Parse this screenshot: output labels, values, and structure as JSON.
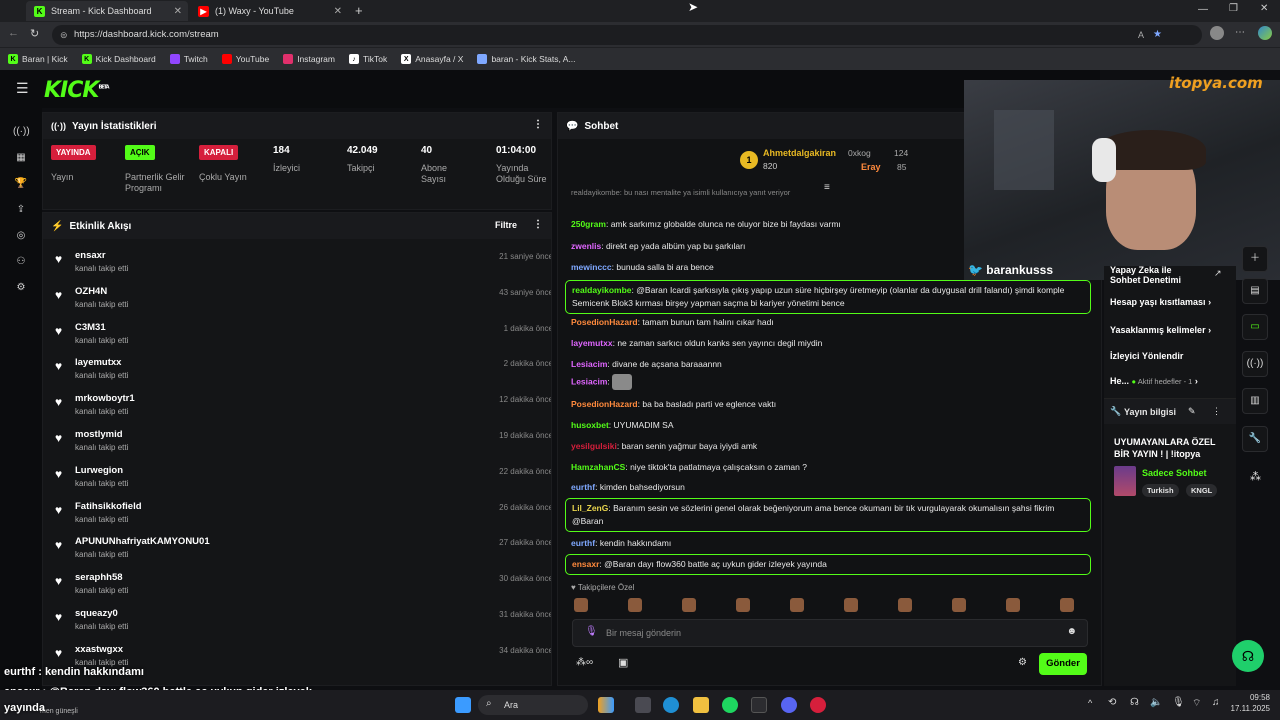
{
  "browser": {
    "tabs": [
      {
        "title": "Stream - Kick Dashboard",
        "active": true,
        "icon": "kick-icon"
      },
      {
        "title": "(1) Waxy - YouTube",
        "active": false,
        "icon": "youtube-icon"
      }
    ],
    "url": "https://dashboard.kick.com/stream",
    "bookmarks": [
      "Baran | Kick",
      "Kick Dashboard",
      "Twitch",
      "YouTube",
      "Instagram",
      "TikTok",
      "Anasayfa / X",
      "baran - Kick Stats, A..."
    ]
  },
  "app": {
    "logo": "KICK",
    "logo_sup": "BETA",
    "stats": {
      "title": "Yayın İstatistikleri",
      "items": [
        {
          "badge": "YAYINDA",
          "label": "Yayın"
        },
        {
          "badge": "AÇIK",
          "label": "Partnerlik Gelir Programı"
        },
        {
          "badge": "KAPALI",
          "label": "Çoklu Yayın"
        },
        {
          "num": "184",
          "label": "İzleyici"
        },
        {
          "num": "42.049",
          "label": "Takipçi"
        },
        {
          "num": "40",
          "label": "Abone Sayısı"
        },
        {
          "num": "01:04:00",
          "label": "Yayında Olduğu Süre"
        }
      ]
    },
    "activity": {
      "title": "Etkinlik Akışı",
      "filter": "Filtre",
      "items": [
        {
          "name": "ensaxr",
          "sub": "kanalı takip etti",
          "time": "21 saniye önce"
        },
        {
          "name": "OZH4N",
          "sub": "kanalı takip etti",
          "time": "43 saniye önce"
        },
        {
          "name": "C3M31",
          "sub": "kanalı takip etti",
          "time": "1 dakika önce"
        },
        {
          "name": "layemutxx",
          "sub": "kanalı takip etti",
          "time": "2 dakika önce"
        },
        {
          "name": "mrkowboytr1",
          "sub": "kanalı takip etti",
          "time": "12 dakika önce"
        },
        {
          "name": "mostlymid",
          "sub": "kanalı takip etti",
          "time": "19 dakika önce"
        },
        {
          "name": "Lurwegion",
          "sub": "kanalı takip etti",
          "time": "22 dakika önce"
        },
        {
          "name": "Fatihsikkofield",
          "sub": "kanalı takip etti",
          "time": "26 dakika önce"
        },
        {
          "name": "APUNUNhafriyatKAMYONU01",
          "sub": "kanalı takip etti",
          "time": "27 dakika önce"
        },
        {
          "name": "seraphh58",
          "sub": "kanalı takip etti",
          "time": "30 dakika önce"
        },
        {
          "name": "squeazy0",
          "sub": "kanalı takip etti",
          "time": "31 dakika önce"
        },
        {
          "name": "xxastwgxx",
          "sub": "kanalı takip etti",
          "time": "34 dakika önce"
        }
      ]
    },
    "chat": {
      "title": "Sohbet",
      "leader": {
        "rank": "1",
        "name": "Ahmetdalgakiran",
        "amount": "820",
        "second": "0xkog",
        "second_amount": "124",
        "third": "Eray",
        "third_amount": "85"
      },
      "reply_note": "realdayikombe: bu nası mentalite ya isimli kullanıcıya yanıt veriyor",
      "messages": [
        {
          "user": "250gram",
          "color": "#53fc18",
          "text": "amk sarkımız globalde olunca ne oluyor bize bi faydası varmı",
          "hl": false
        },
        {
          "user": "zwenlis",
          "color": "#e066ff",
          "text": "direkt ep yada albüm yap bu şarkıları",
          "hl": false
        },
        {
          "user": "mewinccc",
          "color": "#7fa8ff",
          "text": "bunuda salla bi ara bence",
          "hl": false
        },
        {
          "user": "realdayikombe",
          "color": "#53fc18",
          "text": "@Baran Icardi şarkısıyla çıkış yapıp uzun süre hiçbirşey üretmeyip (olanlar da duygusal drill falandı) şimdi komple Semicenk Blok3 kırması birşey yapman saçma bi kariyer yönetimi bence",
          "hl": true
        },
        {
          "user": "PosedionHazard",
          "color": "#ff8a3d",
          "text": "tamam bunun tam halını cıkar hadı",
          "hl": false
        },
        {
          "user": "layemutxx",
          "color": "#e066ff",
          "text": "ne zaman sarkıcı oldun kanks sen yayıncı degil miydin",
          "hl": false
        },
        {
          "user": "Lesiacim",
          "color": "#e066ff",
          "text": "divane de açsana baraaannn",
          "hl": false
        },
        {
          "user": "Lesiacim",
          "color": "#e066ff",
          "text": "",
          "hl": false,
          "emote": true
        },
        {
          "user": "PosedionHazard",
          "color": "#ff8a3d",
          "text": "ba ba basladı parti ve eglence vaktı",
          "hl": false
        },
        {
          "user": "husoxbet",
          "color": "#53fc18",
          "text": "UYUMADIM SA",
          "hl": false
        },
        {
          "user": "yesilgulsiki",
          "color": "#d61f3c",
          "text": "baran senin yağmur baya iyiydi amk",
          "hl": false
        },
        {
          "user": "HamzahanCS",
          "color": "#53fc18",
          "text": "niye tiktok'ta patlatmaya çalışcaksın o zaman ?",
          "hl": false
        },
        {
          "user": "eurthf",
          "color": "#7fa8ff",
          "text": "kimden bahsediyorsun",
          "hl": false
        },
        {
          "user": "Lil_ZenG",
          "color": "#e8d44d",
          "text": "Baranım sesin ve sözlerini genel olarak beğeniyorum ama bence okumanı bir tık vurgulayarak okumalısın şahsi fikrim @Baran",
          "hl": true
        },
        {
          "user": "eurthf",
          "color": "#7fa8ff",
          "text": "kendin hakkındamı",
          "hl": false
        },
        {
          "user": "ensaxr",
          "color": "#ff8a3d",
          "text": "@Baran dayı flow360 battle aç uykun gider izleyek yayında",
          "hl": true
        }
      ],
      "subscribers_label": "Takipçilere Özel",
      "input_placeholder": "Bir mesaj gönderin",
      "send": "Gönder"
    },
    "right": {
      "menu": [
        "Yapay Zeka ile Sohbet Denetimi",
        "Hesap yaşı kısıtlaması",
        "Yasaklanmış kelimeler",
        "İzleyici Yönlendir",
        "He...",
        "Aktif hedefler - 1"
      ],
      "stream_info_title": "Yayın bilgisi",
      "stream_title": "UYUMAYANLARA ÖZEL BİR YAYIN ! | !itopya",
      "category": "Sadece Sohbet",
      "tags": [
        "Turkish",
        "KNGL"
      ]
    },
    "webcam": {
      "handle": "barankusss",
      "brand": "itopya.com"
    }
  },
  "overlay": {
    "line1": "eurthf : kendin hakkındamı",
    "line2": "ensaxr : @Baran dayı flow360 battle aç uykun gider izleyek",
    "line3": "yayında"
  },
  "taskbar": {
    "search": "Ara",
    "weather": "men güneşli",
    "time": "09:58",
    "date": "17.11.2025"
  }
}
